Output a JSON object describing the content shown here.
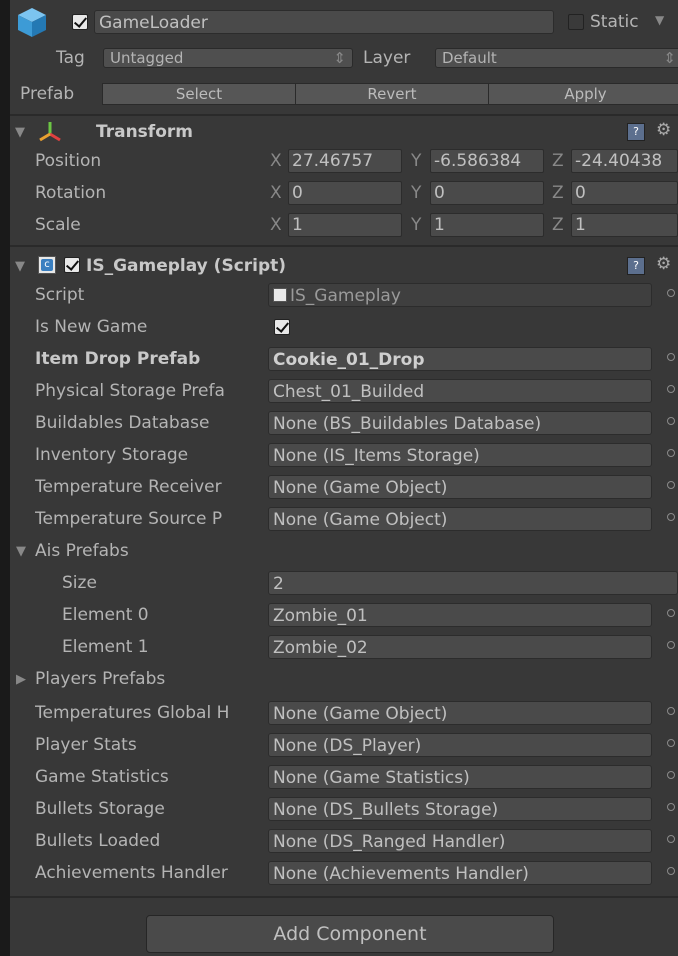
{
  "header": {
    "name": "GameLoader",
    "static_label": "Static",
    "tag_label": "Tag",
    "tag_value": "Untagged",
    "layer_label": "Layer",
    "layer_value": "Default",
    "prefab_label": "Prefab",
    "select_label": "Select",
    "revert_label": "Revert",
    "apply_label": "Apply"
  },
  "transform": {
    "title": "Transform",
    "position_label": "Position",
    "rotation_label": "Rotation",
    "scale_label": "Scale",
    "axis_x": "X",
    "axis_y": "Y",
    "axis_z": "Z",
    "position": {
      "x": "27.46757",
      "y": "-6.586384",
      "z": "-24.40438"
    },
    "rotation": {
      "x": "0",
      "y": "0",
      "z": "0"
    },
    "scale": {
      "x": "1",
      "y": "1",
      "z": "1"
    }
  },
  "component": {
    "title": "IS_Gameplay (Script)",
    "fields": [
      {
        "label": "Script",
        "value": "IS_Gameplay"
      },
      {
        "label": "Is New Game",
        "value": ""
      },
      {
        "label": "Item Drop Prefab",
        "value": "Cookie_01_Drop"
      },
      {
        "label": "Physical Storage Prefa",
        "value": "Chest_01_Builded"
      },
      {
        "label": "Buildables Database",
        "value": "None (BS_Buildables Database)"
      },
      {
        "label": "Inventory Storage",
        "value": "None (IS_Items Storage)"
      },
      {
        "label": "Temperature Receiver",
        "value": "None (Game Object)"
      },
      {
        "label": "Temperature Source P",
        "value": "None (Game Object)"
      },
      {
        "label": "Ais Prefabs",
        "value": ""
      },
      {
        "label": "Size",
        "value": "2"
      },
      {
        "label": "Element 0",
        "value": "Zombie_01"
      },
      {
        "label": "Element 1",
        "value": "Zombie_02"
      },
      {
        "label": "Players Prefabs",
        "value": ""
      },
      {
        "label": "Temperatures Global H",
        "value": "None (Game Object)"
      },
      {
        "label": "Player Stats",
        "value": "None (DS_Player)"
      },
      {
        "label": "Game Statistics",
        "value": "None (Game Statistics)"
      },
      {
        "label": "Bullets Storage",
        "value": "None (DS_Bullets Storage)"
      },
      {
        "label": "Bullets Loaded",
        "value": "None (DS_Ranged Handler)"
      },
      {
        "label": "Achievements Handler",
        "value": "None (Achievements Handler)"
      }
    ]
  },
  "footer": {
    "add_component_label": "Add Component"
  },
  "icons": {
    "gameobject": "cube-icon",
    "transform": "axes-icon",
    "script": "script-icon",
    "help": "help-icon",
    "gear": "gear-icon"
  },
  "colors": {
    "panel_bg": "#383838",
    "field_bg": "#4a4a4a",
    "cube_blue": "#3d9bd6"
  }
}
